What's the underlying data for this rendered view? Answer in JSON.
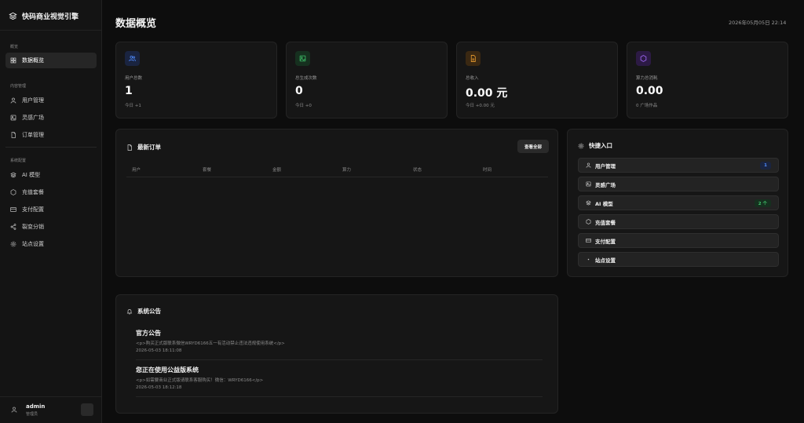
{
  "app": {
    "name": "快码商业视觉引擎"
  },
  "header": {
    "title": "数据概览",
    "datetime": "2026年05月05日 22:14"
  },
  "sidebar": {
    "sections": [
      {
        "label": "概览"
      },
      {
        "label": "内容管理"
      },
      {
        "label": "系统配置"
      }
    ],
    "items": [
      {
        "label": "数据概览",
        "icon": "grid-icon",
        "active": true
      },
      {
        "label": "用户管理",
        "icon": "user-icon"
      },
      {
        "label": "灵感广场",
        "icon": "image-icon"
      },
      {
        "label": "订单管理",
        "icon": "document-icon"
      },
      {
        "label": "AI 模型",
        "icon": "layers-icon"
      },
      {
        "label": "充值套餐",
        "icon": "hexagon-icon"
      },
      {
        "label": "支付配置",
        "icon": "credit-card-icon"
      },
      {
        "label": "裂变分销",
        "icon": "share-icon"
      },
      {
        "label": "站点设置",
        "icon": "gear-icon"
      }
    ],
    "user": {
      "name": "admin",
      "role": "管理员"
    }
  },
  "stats": [
    {
      "label": "用户总数",
      "value": "1",
      "sub": "今日 +1",
      "icon": "users-icon",
      "color": "#4f8cff"
    },
    {
      "label": "总生成次数",
      "value": "0",
      "sub": "今日 +0",
      "icon": "image-icon",
      "color": "#3fc46a"
    },
    {
      "label": "总收入",
      "value": "0.00 元",
      "sub": "今日 +0.00 元",
      "icon": "document-icon",
      "color": "#f0a030"
    },
    {
      "label": "算力总消耗",
      "value": "0.00",
      "sub": "0 广场作品",
      "icon": "hexagon-icon",
      "color": "#a66cff"
    }
  ],
  "orders": {
    "title": "最新订单",
    "view_all": "查看全部",
    "columns": [
      "用户",
      "套餐",
      "金额",
      "算力",
      "状态",
      "时间"
    ]
  },
  "quick": {
    "title": "快捷入口",
    "items": [
      {
        "label": "用户管理",
        "icon": "user-icon",
        "badge": "1"
      },
      {
        "label": "灵感广场",
        "icon": "image-icon"
      },
      {
        "label": "AI 模型",
        "icon": "layers-icon",
        "badge": "2 个"
      },
      {
        "label": "充值套餐",
        "icon": "hexagon-icon"
      },
      {
        "label": "支付配置",
        "icon": "credit-card-icon"
      },
      {
        "label": "站点设置",
        "icon": "gear-icon"
      }
    ]
  },
  "notices": {
    "title": "系统公告",
    "items": [
      {
        "title": "官方公告",
        "body": "<p>购买正式版联系微信WRYD6166五一有活动禁止违法违规使用系统</p>",
        "time": "2026-05-03 18:11:08"
      },
      {
        "title": "您正在使用公益版系统",
        "body": "<p>如需要商业正式版请联系客服购买！微信：WRYD6166</p>",
        "time": "2026-05-03 18:12:18"
      }
    ]
  },
  "colors": {
    "badge_blue": "#4f8cff",
    "badge_green": "#3fc46a"
  }
}
